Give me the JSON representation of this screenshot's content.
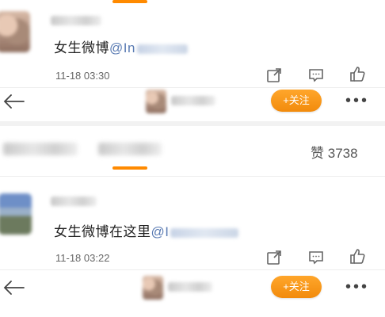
{
  "comment1": {
    "text": "女生微博",
    "mention_prefix": "@In",
    "timestamp": "11-18 03:30"
  },
  "toolbar1": {
    "follow_label": "+关注",
    "more_label": "•••"
  },
  "tabs": {
    "likes_label": "赞",
    "likes_count": "3738"
  },
  "comment2": {
    "text": "女生微博在这里",
    "mention_prefix": "@I",
    "timestamp": "11-18 03:22"
  },
  "toolbar2": {
    "follow_label": "+关注",
    "more_label": "•••"
  },
  "colors": {
    "accent": "#ff8a00",
    "mention": "#5a7bb3"
  }
}
